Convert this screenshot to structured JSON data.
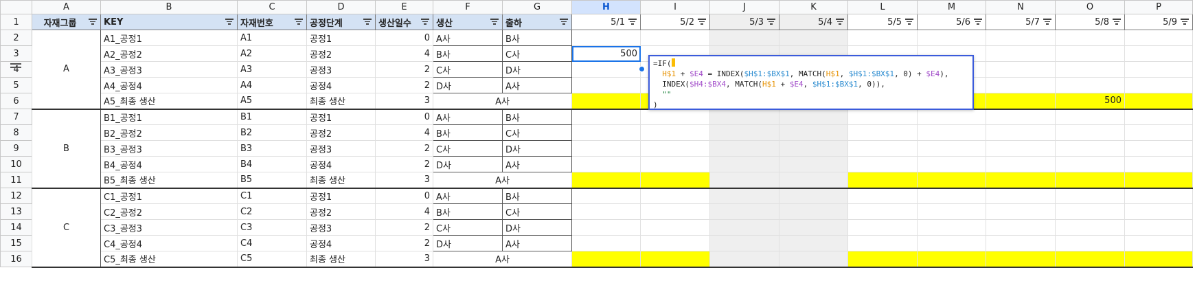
{
  "columns": [
    "A",
    "B",
    "C",
    "D",
    "E",
    "F",
    "G",
    "H",
    "I",
    "J",
    "K",
    "L",
    "M",
    "N",
    "O",
    "P"
  ],
  "header": {
    "group": "자재그룹",
    "key": "KEY",
    "material_no": "자재번호",
    "stage": "공정단계",
    "days": "생산일수",
    "production": "생산",
    "shipping": "출하",
    "dates": [
      "5/1",
      "5/2",
      "5/3",
      "5/4",
      "5/5",
      "5/6",
      "5/7",
      "5/8",
      "5/9"
    ]
  },
  "rows": [
    {
      "n": "2",
      "key": "A1_공정1",
      "mat": "A1",
      "stage": "공정1",
      "days": "0",
      "prod": "A사",
      "ship": "B사"
    },
    {
      "n": "3",
      "key": "A2_공정2",
      "mat": "A2",
      "stage": "공정2",
      "days": "4",
      "prod": "B사",
      "ship": "C사",
      "h": "500"
    },
    {
      "n": "4",
      "key": "A3_공정3",
      "mat": "A3",
      "stage": "공정3",
      "days": "2",
      "prod": "C사",
      "ship": "D사"
    },
    {
      "n": "5",
      "key": "A4_공정4",
      "mat": "A4",
      "stage": "공정4",
      "days": "2",
      "prod": "D사",
      "ship": "A사"
    },
    {
      "n": "6",
      "key": "A5_최종 생산",
      "mat": "A5",
      "stage": "최종 생산",
      "days": "3",
      "final": "A사",
      "o": "500"
    },
    {
      "n": "7",
      "key": "B1_공정1",
      "mat": "B1",
      "stage": "공정1",
      "days": "0",
      "prod": "A사",
      "ship": "B사"
    },
    {
      "n": "8",
      "key": "B2_공정2",
      "mat": "B2",
      "stage": "공정2",
      "days": "4",
      "prod": "B사",
      "ship": "C사"
    },
    {
      "n": "9",
      "key": "B3_공정3",
      "mat": "B3",
      "stage": "공정3",
      "days": "2",
      "prod": "C사",
      "ship": "D사"
    },
    {
      "n": "10",
      "key": "B4_공정4",
      "mat": "B4",
      "stage": "공정4",
      "days": "2",
      "prod": "D사",
      "ship": "A사"
    },
    {
      "n": "11",
      "key": "B5_최종 생산",
      "mat": "B5",
      "stage": "최종 생산",
      "days": "3",
      "final": "A사"
    },
    {
      "n": "12",
      "key": "C1_공정1",
      "mat": "C1",
      "stage": "공정1",
      "days": "0",
      "prod": "A사",
      "ship": "B사"
    },
    {
      "n": "13",
      "key": "C2_공정2",
      "mat": "C2",
      "stage": "공정2",
      "days": "4",
      "prod": "B사",
      "ship": "C사"
    },
    {
      "n": "14",
      "key": "C3_공정3",
      "mat": "C3",
      "stage": "공정3",
      "days": "2",
      "prod": "C사",
      "ship": "D사"
    },
    {
      "n": "15",
      "key": "C4_공정4",
      "mat": "C4",
      "stage": "공정4",
      "days": "2",
      "prod": "D사",
      "ship": "A사"
    },
    {
      "n": "16",
      "key": "C5_최종 생산",
      "mat": "C5",
      "stage": "최종 생산",
      "days": "3",
      "final": "A사"
    }
  ],
  "groups": [
    "A",
    "B",
    "C"
  ],
  "formula": {
    "l1": "=IF(",
    "l2a": "H$1",
    "l2b": " + ",
    "l2c": "$E4",
    "l2d": " = INDEX(",
    "l2e": "$H$1:$BX$1",
    "l2f": ", MATCH(",
    "l2g": "H$1",
    "l2h": ", ",
    "l2i": "$H$1:$BX$1",
    "l2j": ", 0) + ",
    "l2k": "$E4",
    "l2l": "),",
    "l3a": "INDEX(",
    "l3b": "$H4:$BX4",
    "l3c": ", MATCH(",
    "l3d": "H$1",
    "l3e": " + ",
    "l3f": "$E4",
    "l3g": ", ",
    "l3h": "$H$1:$BX$1",
    "l3i": ", 0)),",
    "l4": "\"\"",
    "l5": ")"
  },
  "colors": {
    "header_fill": "#d4e2f4",
    "highlight": "#ffff00",
    "weekend_fill": "#efefef",
    "selection": "#1a73e8"
  }
}
